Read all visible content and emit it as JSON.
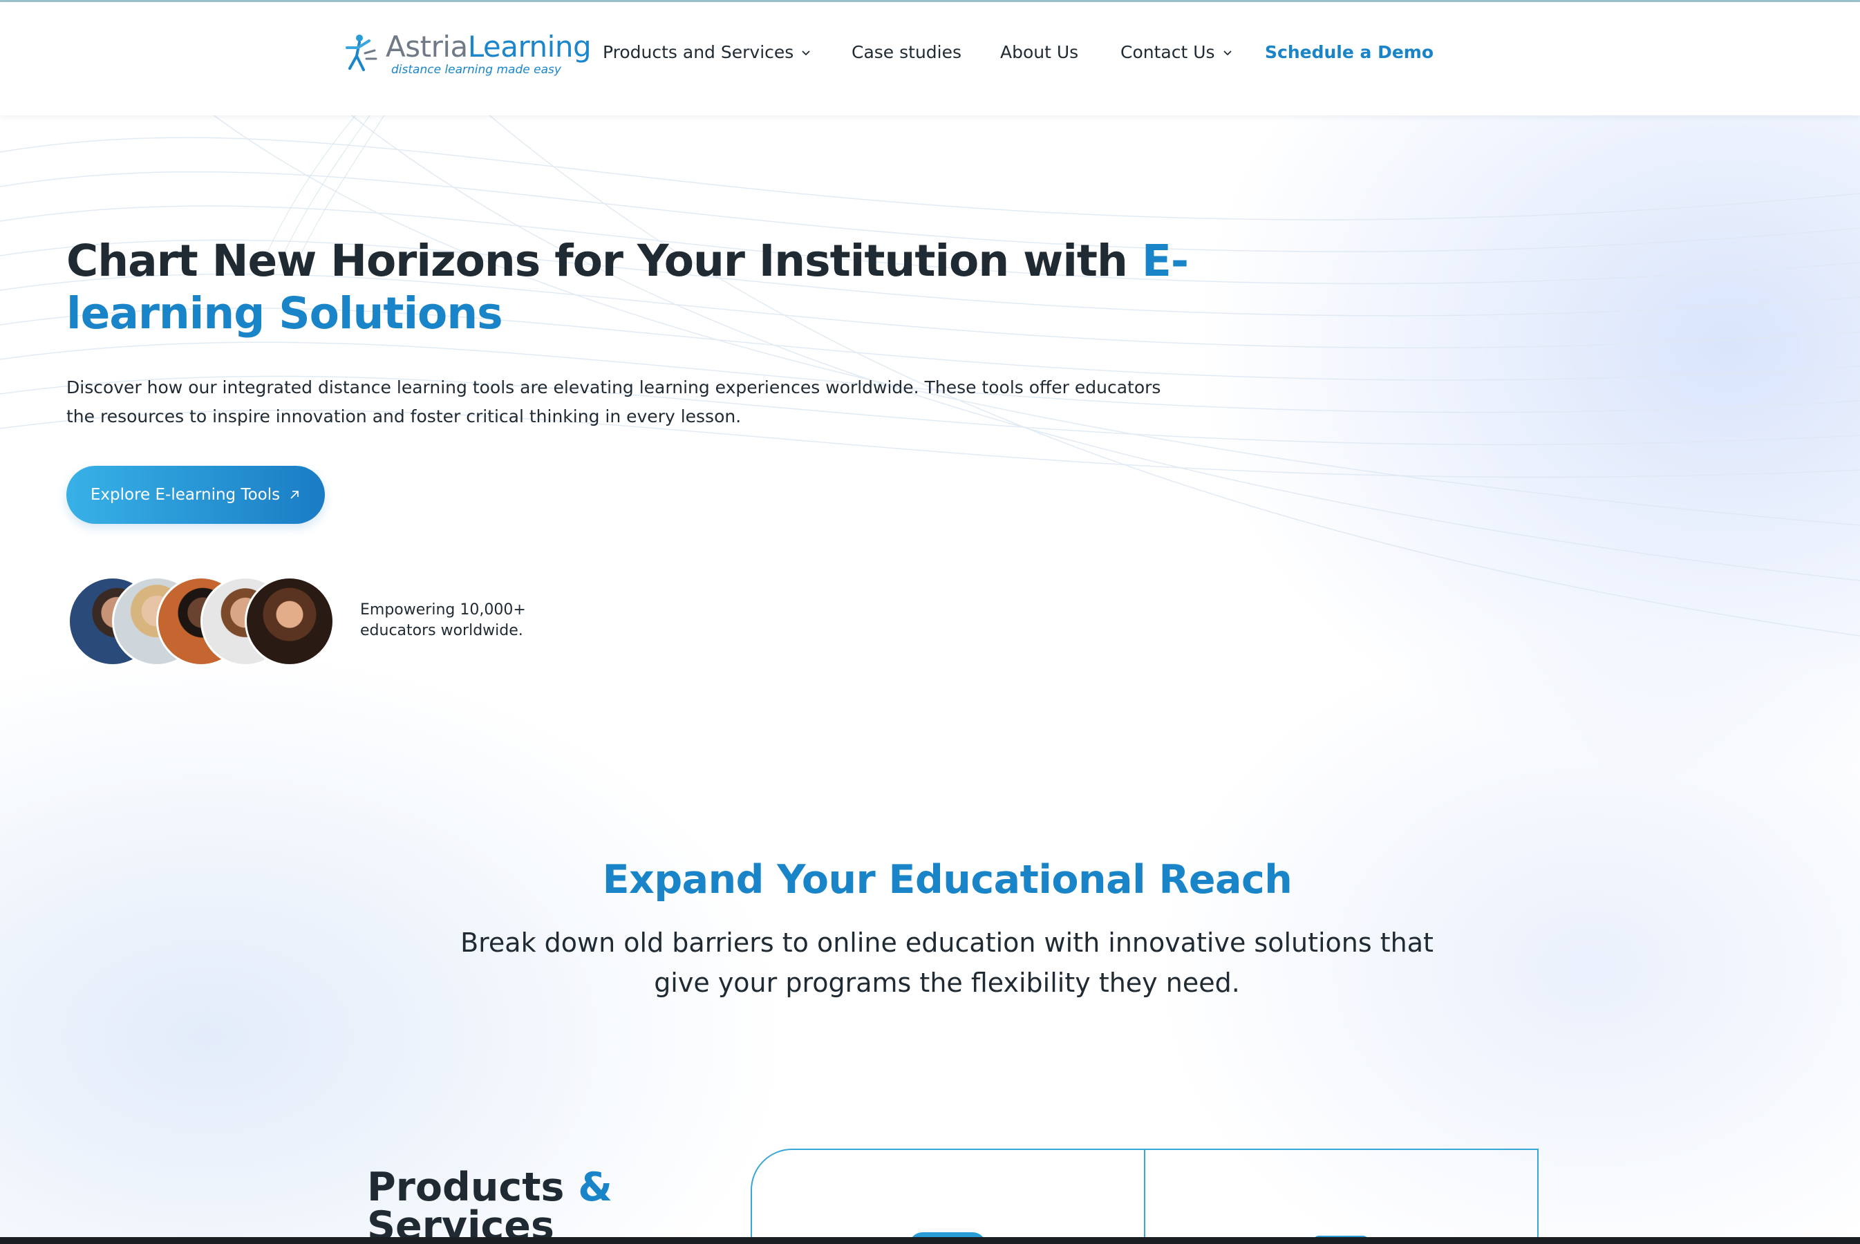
{
  "header": {
    "logo": {
      "name_part1": "Astria",
      "name_part2": "Learning",
      "tagline": "distance learning made easy"
    },
    "nav": [
      {
        "label": "Products and Services",
        "has_dropdown": true
      },
      {
        "label": "Case studies",
        "has_dropdown": false
      },
      {
        "label": "About Us",
        "has_dropdown": false
      },
      {
        "label": "Contact Us",
        "has_dropdown": true
      }
    ],
    "cta": "Schedule a Demo"
  },
  "hero": {
    "title_main": "Chart New Horizons for Your Institution with ",
    "title_accent": "E-learning Solutions",
    "description": "Discover how our integrated distance learning tools are elevating learning experiences worldwide. These tools offer educators the resources to inspire innovation and foster critical thinking in every lesson.",
    "button_label": "Explore E-learning Tools",
    "social_proof": "Empowering 10,000+ educators worldwide."
  },
  "reach": {
    "title": "Expand Your Educational Reach",
    "subtitle": "Break down old barriers to online education with innovative solutions that give your programs the flexibility they need."
  },
  "products": {
    "title_part1": "Products ",
    "title_amp": "&",
    "title_part2": "Services"
  },
  "colors": {
    "accent": "#1a84c8",
    "text": "#1f2a33",
    "button_start": "#38b1e7",
    "button_end": "#1a7cc4"
  },
  "icons": {
    "nav_dropdown": "chevron-down-icon",
    "button_arrow": "arrow-up-right-icon",
    "logo_mark": "figure-logo-icon"
  }
}
